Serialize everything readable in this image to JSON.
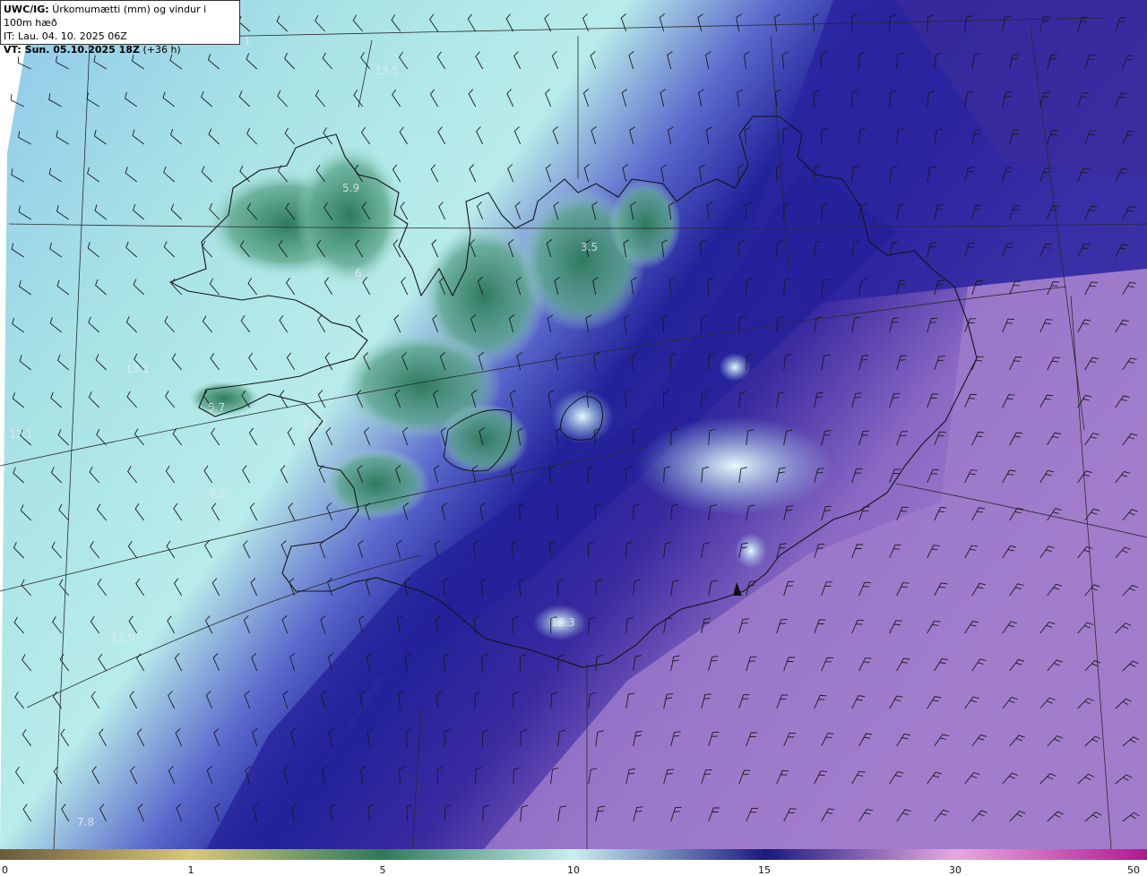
{
  "header": {
    "product": "UWC/IG:",
    "product_desc": "Úrkomumætti (mm) og vindur i 100m hæð",
    "init_time": "IT: Lau. 04. 10. 2025 06Z",
    "valid_prefix": "VT: Sun. 05.10.2025 18Z",
    "valid_lead": "(+36 h)"
  },
  "map_labels": [
    {
      "id": "label-13-5",
      "text": "13.5"
    },
    {
      "id": "label-1-top",
      "text": "1"
    },
    {
      "id": "label-5-9",
      "text": "5.9"
    },
    {
      "id": "label-6",
      "text": "6"
    },
    {
      "id": "label-3-5",
      "text": "3.5"
    },
    {
      "id": "label-13-1",
      "text": "13.1"
    },
    {
      "id": "label-5-7",
      "text": "5.7"
    },
    {
      "id": "label-13-7",
      "text": "13.7"
    },
    {
      "id": "label-12-1",
      "text": "12.1"
    },
    {
      "id": "label-9-2",
      "text": "9.2"
    },
    {
      "id": "label-12-9",
      "text": "12.9"
    },
    {
      "id": "label-12-3",
      "text": "12.3"
    },
    {
      "id": "label-7-8",
      "text": "7.8"
    }
  ],
  "colorbar": {
    "ticks": [
      "0",
      "1",
      "5",
      "10",
      "15",
      "30",
      "50"
    ],
    "stops": [
      {
        "v": 0,
        "color": "#6b5a3a"
      },
      {
        "v": 1,
        "color": "#d8c878"
      },
      {
        "v": 5,
        "color": "#2d7a5a"
      },
      {
        "v": 10,
        "color": "#c8f0f0"
      },
      {
        "v": 15,
        "color": "#1a1a80"
      },
      {
        "v": 30,
        "color": "#e8a8e0"
      },
      {
        "v": 50,
        "color": "#b01890"
      }
    ]
  },
  "colors": {
    "land_green": "#3f8f73",
    "light_cyan": "#bdeaea",
    "mid_blue": "#5560c8",
    "deep_blue": "#20208f",
    "purple": "#9a72c8",
    "coast": "#1a1a1a",
    "grid": "#2a2a2a"
  }
}
